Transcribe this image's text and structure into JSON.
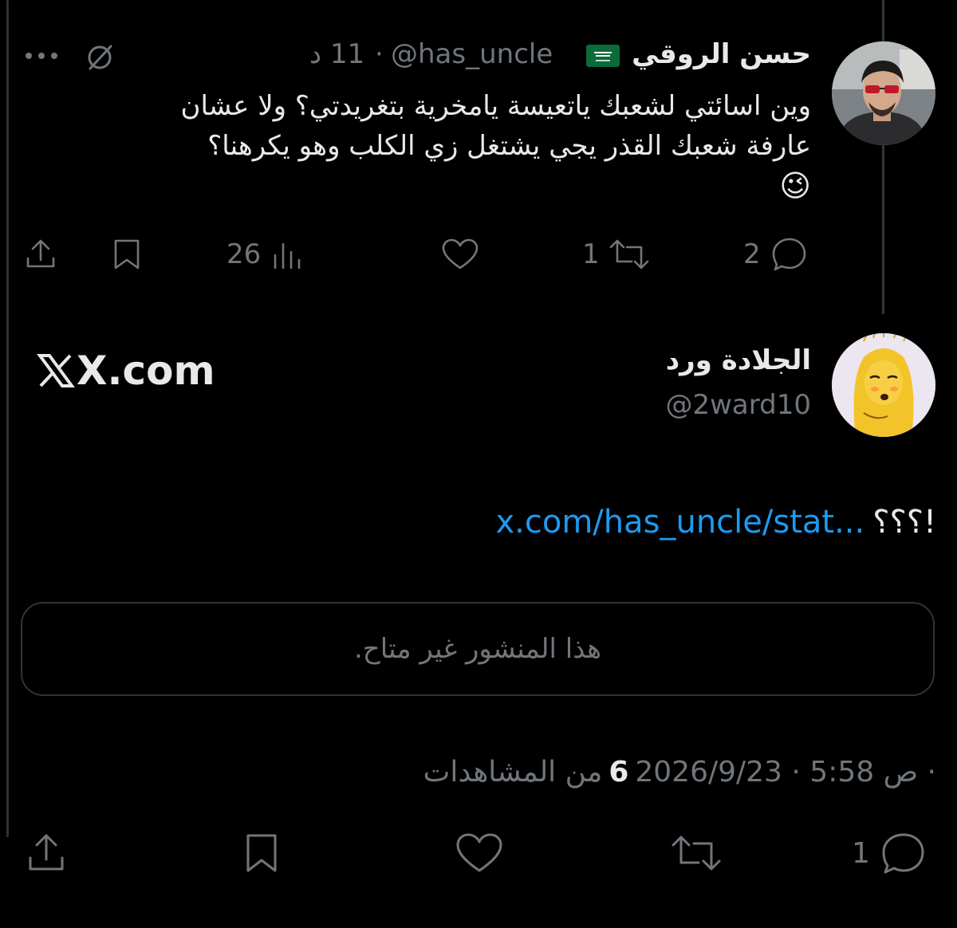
{
  "tweet1": {
    "name": "حسن الروقي",
    "handle": "@has_uncle",
    "time": "11 د",
    "dot": "·",
    "lines": [
      "وين اسائتي لشعبك ياتعيسة يامخرية بتغريدتي؟ ولا عشان",
      "عارفة شعبك القذر يجي يشتغل زي الكلب وهو يكرهنا؟",
      "😉"
    ],
    "replies": "2",
    "retweets": "1",
    "views": "26"
  },
  "tweet2": {
    "name": "الجلادة ورد",
    "handle": "@2ward10",
    "source": "X.com",
    "text_prefix": "؟؟؟!",
    "link": "x.com/has_uncle/stat...",
    "unavailable": "هذا المنشور غير متاح.",
    "timestamp": "2026/9/23 · 5:58 ص ·",
    "views_count": "6",
    "views_label": "من المشاهدات",
    "replies": "1"
  },
  "icons": {
    "saudi_flag": "saudi-flag-icon",
    "grok": "grok-icon",
    "more": "more-icon",
    "share": "share-icon",
    "bookmark": "bookmark-icon",
    "views": "views-icon",
    "like": "heart-icon",
    "retweet": "retweet-icon",
    "reply": "reply-icon"
  },
  "colors": {
    "background": "#000000",
    "text": "#e7e9ea",
    "muted": "#71767b",
    "link": "#1d9bf0",
    "flag": "#0b6b3a"
  }
}
